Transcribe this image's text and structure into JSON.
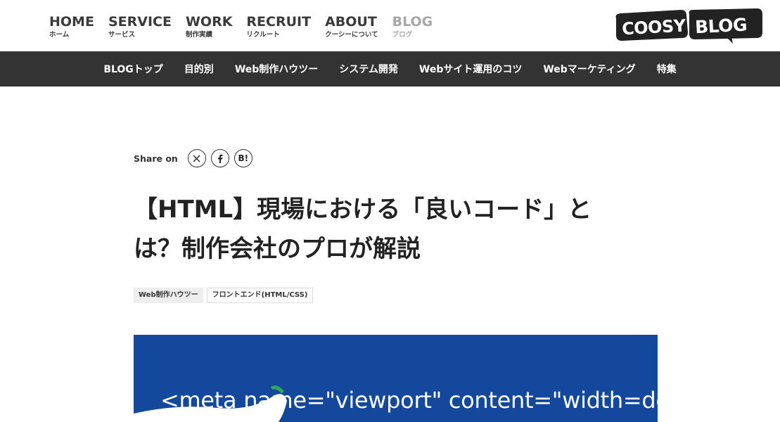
{
  "header": {
    "nav": [
      {
        "en": "HOME",
        "ja": "ホーム",
        "current": false
      },
      {
        "en": "SERVICE",
        "ja": "サービス",
        "current": false
      },
      {
        "en": "WORK",
        "ja": "制作実績",
        "current": false
      },
      {
        "en": "RECRUIT",
        "ja": "リクルート",
        "current": false
      },
      {
        "en": "ABOUT",
        "ja": "クーシーについて",
        "current": false
      },
      {
        "en": "BLOG",
        "ja": "ブログ",
        "current": true
      }
    ],
    "logo_text": "COOSY BLOG"
  },
  "subnav": {
    "items": [
      "BLOGトップ",
      "目的別",
      "Web制作ハウツー",
      "システム開発",
      "Webサイト運用のコツ",
      "Webマーケティング",
      "特集"
    ]
  },
  "article": {
    "share_label": "Share on",
    "share_buttons": {
      "x": "x-icon",
      "facebook": "facebook-icon",
      "hatena": "B!"
    },
    "title_line1": "【HTML】現場における「良いコード」と",
    "title_line2": "は？制作会社のプロが解説",
    "tags": [
      "Web制作ハウツー",
      "フロントエンド(HTML/CSS)"
    ],
    "hero_code": "<meta name=\"viewport\" content=\"width=de"
  },
  "colors": {
    "nav_text": "#3a3a3a",
    "nav_current": "#a7a7a7",
    "subnav_bg": "#333333",
    "hero_bg": "#14489c"
  }
}
